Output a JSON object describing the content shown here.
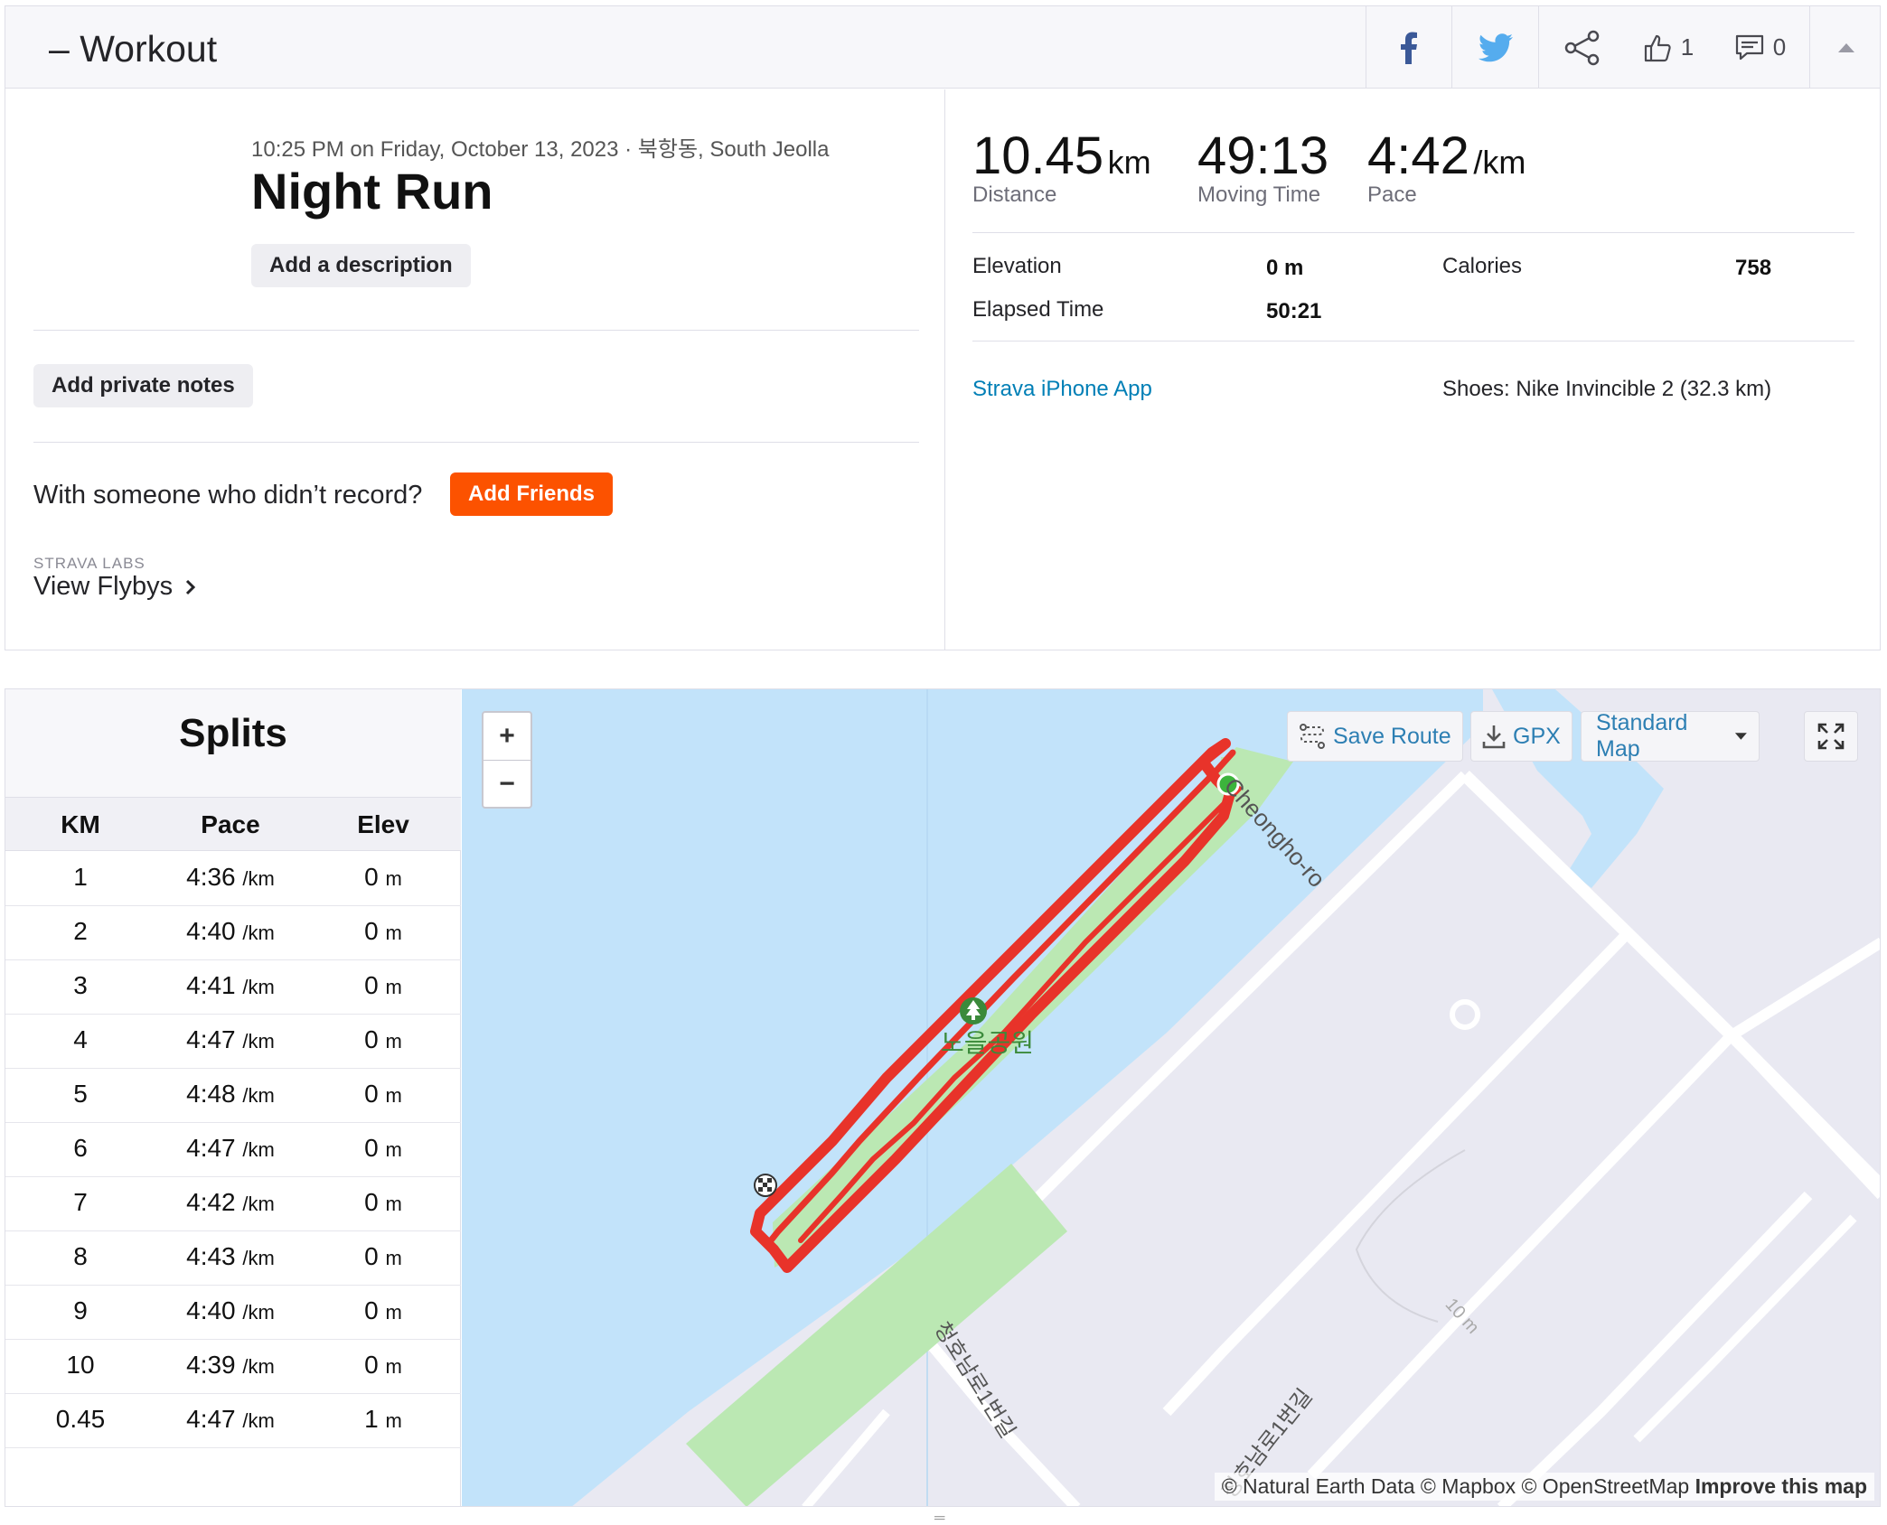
{
  "header": {
    "title": "– Workout",
    "kudos_count": "1",
    "comment_count": "0",
    "icons": [
      "facebook-icon",
      "twitter-icon",
      "share-icon",
      "thumbs-up-icon",
      "comment-icon",
      "collapse-icon"
    ]
  },
  "activity": {
    "datetime_location": "10:25 PM on Friday, October 13, 2023 · 북항동, South Jeolla",
    "name": "Night Run",
    "add_description_label": "Add a description",
    "add_private_notes_label": "Add private notes",
    "friends_question": "With someone who didn’t record?",
    "add_friends_label": "Add Friends",
    "labs_label": "STRAVA LABS",
    "view_flybys_label": "View Flybys"
  },
  "stats": {
    "distance": {
      "value": "10.45",
      "unit": "km",
      "label": "Distance"
    },
    "moving_time": {
      "value": "49:13",
      "label": "Moving Time"
    },
    "pace": {
      "value": "4:42",
      "unit": "/km",
      "label": "Pace"
    },
    "elevation_label": "Elevation",
    "elevation_value": "0 m",
    "elapsed_label": "Elapsed Time",
    "elapsed_value": "50:21",
    "calories_label": "Calories",
    "calories_value": "758",
    "device": "Strava iPhone App",
    "shoes": "Shoes: Nike Invincible 2 (32.3 km)"
  },
  "splits": {
    "title": "Splits",
    "columns": [
      "KM",
      "Pace",
      "Elev"
    ],
    "pace_unit": "/km",
    "elev_unit": "m",
    "rows": [
      {
        "km": "1",
        "pace": "4:36",
        "elev": "0"
      },
      {
        "km": "2",
        "pace": "4:40",
        "elev": "0"
      },
      {
        "km": "3",
        "pace": "4:41",
        "elev": "0"
      },
      {
        "km": "4",
        "pace": "4:47",
        "elev": "0"
      },
      {
        "km": "5",
        "pace": "4:48",
        "elev": "0"
      },
      {
        "km": "6",
        "pace": "4:47",
        "elev": "0"
      },
      {
        "km": "7",
        "pace": "4:42",
        "elev": "0"
      },
      {
        "km": "8",
        "pace": "4:43",
        "elev": "0"
      },
      {
        "km": "9",
        "pace": "4:40",
        "elev": "0"
      },
      {
        "km": "10",
        "pace": "4:39",
        "elev": "0"
      },
      {
        "km": "0.45",
        "pace": "4:47",
        "elev": "1"
      }
    ]
  },
  "map": {
    "zoom_in": "+",
    "zoom_out": "−",
    "save_route_label": "Save Route",
    "gpx_label": "GPX",
    "map_style_label": "Standard Map",
    "park_label": "노을공원",
    "street_1": "Cheongho-ro",
    "street_2": "청호남로1번길",
    "street_3": "청호남로1번길",
    "contour_label": "10 m",
    "attribution": "© Natural Earth Data © Mapbox © OpenStreetMap",
    "improve_label": "Improve this map",
    "colors": {
      "water": "#c2e3fa",
      "park": "#bbe8b3",
      "route": "#e8332a",
      "land": "#e9e9f2",
      "road": "#ffffff",
      "start": "#3cb43c"
    }
  }
}
